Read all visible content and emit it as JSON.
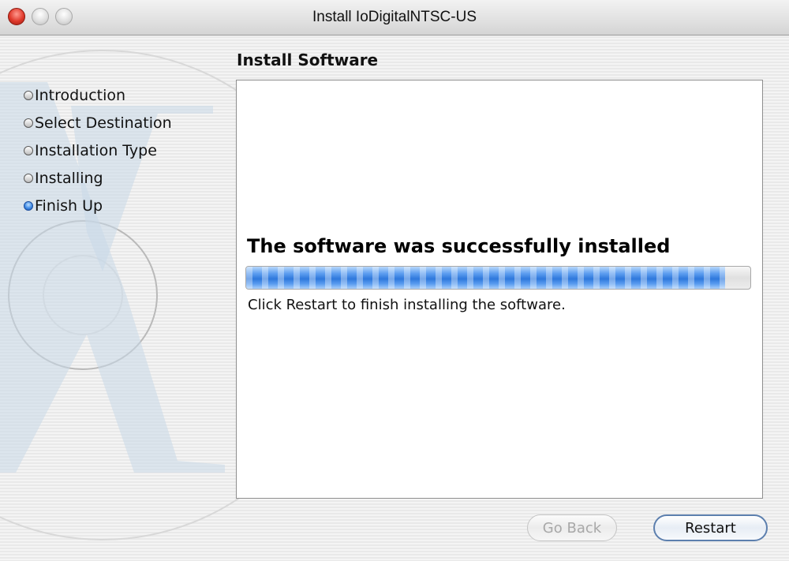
{
  "window": {
    "title": "Install IoDigitalNTSC-US"
  },
  "sidebar": {
    "steps": [
      {
        "label": "Introduction",
        "active": false
      },
      {
        "label": "Select Destination",
        "active": false
      },
      {
        "label": "Installation Type",
        "active": false
      },
      {
        "label": "Installing",
        "active": false
      },
      {
        "label": "Finish Up",
        "active": true
      }
    ]
  },
  "main": {
    "section_title": "Install Software",
    "success_title": "The software was successfully installed",
    "progress_fraction": 0.95,
    "message": "Click Restart to finish installing the software."
  },
  "buttons": {
    "back_label": "Go Back",
    "back_enabled": false,
    "restart_label": "Restart"
  },
  "colors": {
    "accent": "#2e78dc",
    "close_button": "#e0392b"
  }
}
